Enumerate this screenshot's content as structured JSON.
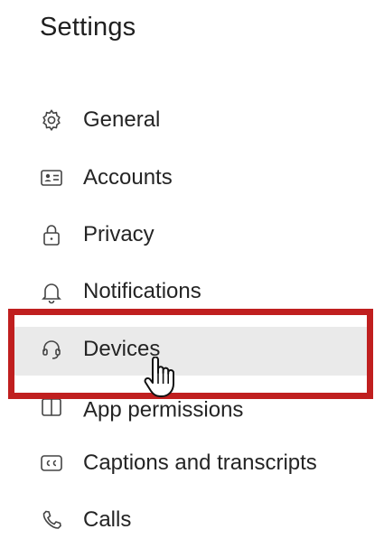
{
  "settings": {
    "title": "Settings",
    "items": [
      {
        "label": "General",
        "icon": "gear-icon"
      },
      {
        "label": "Accounts",
        "icon": "id-card-icon"
      },
      {
        "label": "Privacy",
        "icon": "lock-icon"
      },
      {
        "label": "Notifications",
        "icon": "bell-icon"
      },
      {
        "label": "Devices",
        "icon": "headset-icon",
        "selected": true
      },
      {
        "label": "App permissions",
        "icon": "app-icon"
      },
      {
        "label": "Captions and transcripts",
        "icon": "closed-captions-icon"
      },
      {
        "label": "Calls",
        "icon": "phone-icon"
      }
    ]
  },
  "colors": {
    "highlight_border": "#c01f1f",
    "selected_background": "#eaeaea"
  }
}
